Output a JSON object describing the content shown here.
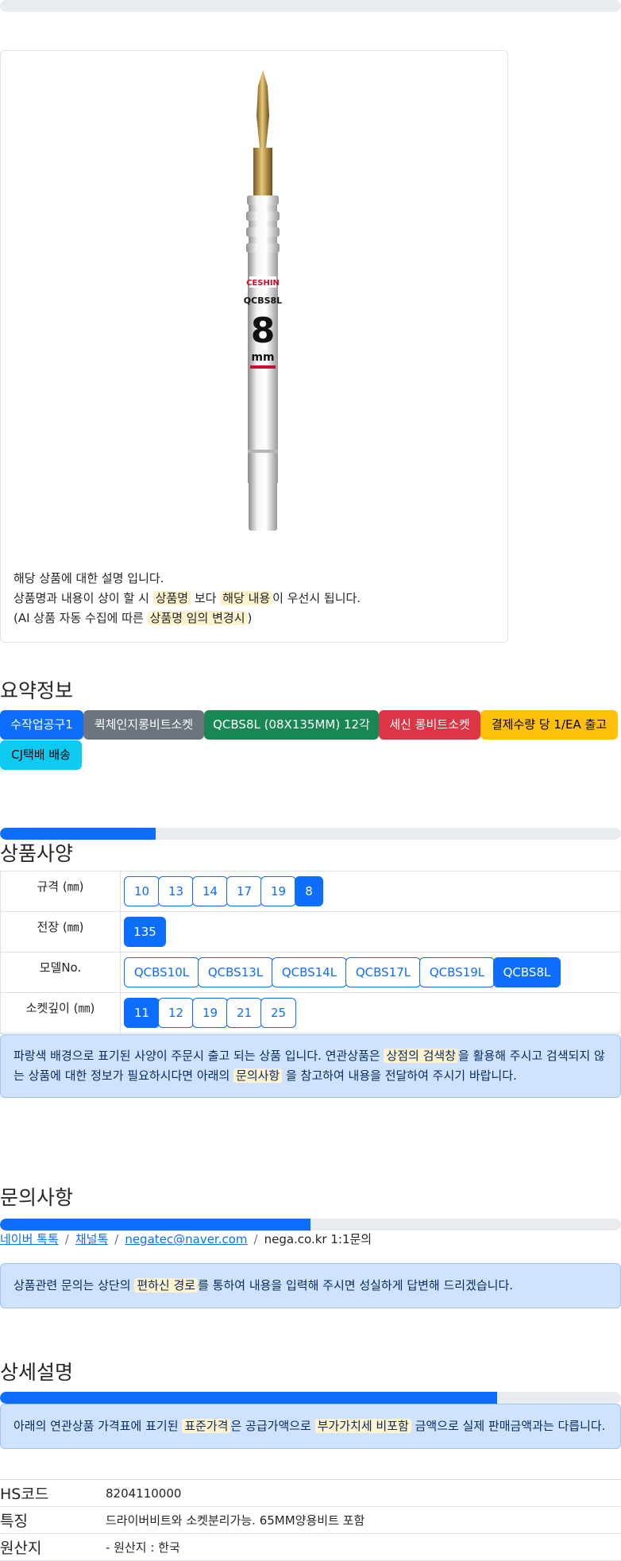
{
  "card": {
    "lines": [
      [
        "해당 상품에 대한 설명 입니다."
      ],
      [
        "상품명과 내용이 상이 할 시 ",
        "상품명",
        " 보다 ",
        "해당 내용",
        "이 우선시 됩니다."
      ],
      [
        "(AI 상품 자동 수집에 따른 ",
        "상품명 임의 변경시",
        ")"
      ]
    ],
    "product_image": {
      "brand": "CESHIN",
      "product_name": "QCBS8L",
      "size_number": "8",
      "size_unit": "mm"
    }
  },
  "summary": {
    "title": "요약정보",
    "badges": [
      {
        "label": "수작업공구1",
        "bg": "#0d6efd",
        "fg": "#ffffff"
      },
      {
        "label": "퀵체인지롱비트소켓",
        "bg": "#6c757d",
        "fg": "#ffffff"
      },
      {
        "label": "QCBS8L (08X135MM) 12각",
        "bg": "#198754",
        "fg": "#ffffff"
      },
      {
        "label": "세신 롱비트소켓",
        "bg": "#dc3545",
        "fg": "#ffffff"
      },
      {
        "label": "결제수량 당 1/EA 출고",
        "bg": "#ffc107",
        "fg": "#000000"
      },
      {
        "label": "CJ택배 배송",
        "bg": "#0dcaf0",
        "fg": "#000000"
      }
    ]
  },
  "specs": {
    "title": "상품사양",
    "progress": 0.25,
    "rows": [
      {
        "label": "규격 (㎜)",
        "options": [
          "10",
          "13",
          "14",
          "17",
          "19",
          "8"
        ],
        "selected": 5
      },
      {
        "label": "전장 (㎜)",
        "options": [
          "135"
        ],
        "selected": 0
      },
      {
        "label": "모델No.",
        "options": [
          "QCBS10L",
          "QCBS13L",
          "QCBS14L",
          "QCBS17L",
          "QCBS19L",
          "QCBS8L"
        ],
        "selected": 5
      },
      {
        "label": "소켓깊이 (㎜)",
        "options": [
          "11",
          "12",
          "19",
          "21",
          "25"
        ],
        "selected": 0
      }
    ],
    "notice": {
      "line1": [
        "파랑색 배경으로 표기된 사양이 주문시 출고 되는 상품 입니다. 연관상품은 ",
        "상점의 검색창",
        "을 활용해 주시고 검색되지 않"
      ],
      "line2": [
        "는 상품에 대한 정보가 필요하시다면 아래의 ",
        "문의사항",
        " 을 참고하여 내용을 전달하여 주시기 바랍니다."
      ]
    }
  },
  "inquiry": {
    "title": "문의사항",
    "progress": 0.5,
    "links": [
      "네이버 톡톡",
      "채널톡",
      "negatec@naver.com"
    ],
    "text": "nega.co.kr 1:1문의",
    "notice": [
      "상품관련 문의는 상단의 ",
      "편하신 경로",
      "를 통하여 내용을 입력해 주시면 성실하게 답변해 드리겠습니다."
    ]
  },
  "detail": {
    "title": "상세설명",
    "progress": 0.8,
    "notice": [
      "아래의 연관상품 가격표에 표기된 ",
      "표준가격",
      "은 공급가액으로 ",
      "부가가치세 비포함",
      " 금액으로 실제 판매금액과는 다릅니다."
    ],
    "rows": [
      {
        "key": "HS코드",
        "value": "8204110000"
      },
      {
        "key": "특징",
        "value": "드라이버비트와 소켓분리가능. 65MM양용비트 포함"
      },
      {
        "key": "원산지",
        "value": "- 원산지 : 한국"
      }
    ]
  }
}
